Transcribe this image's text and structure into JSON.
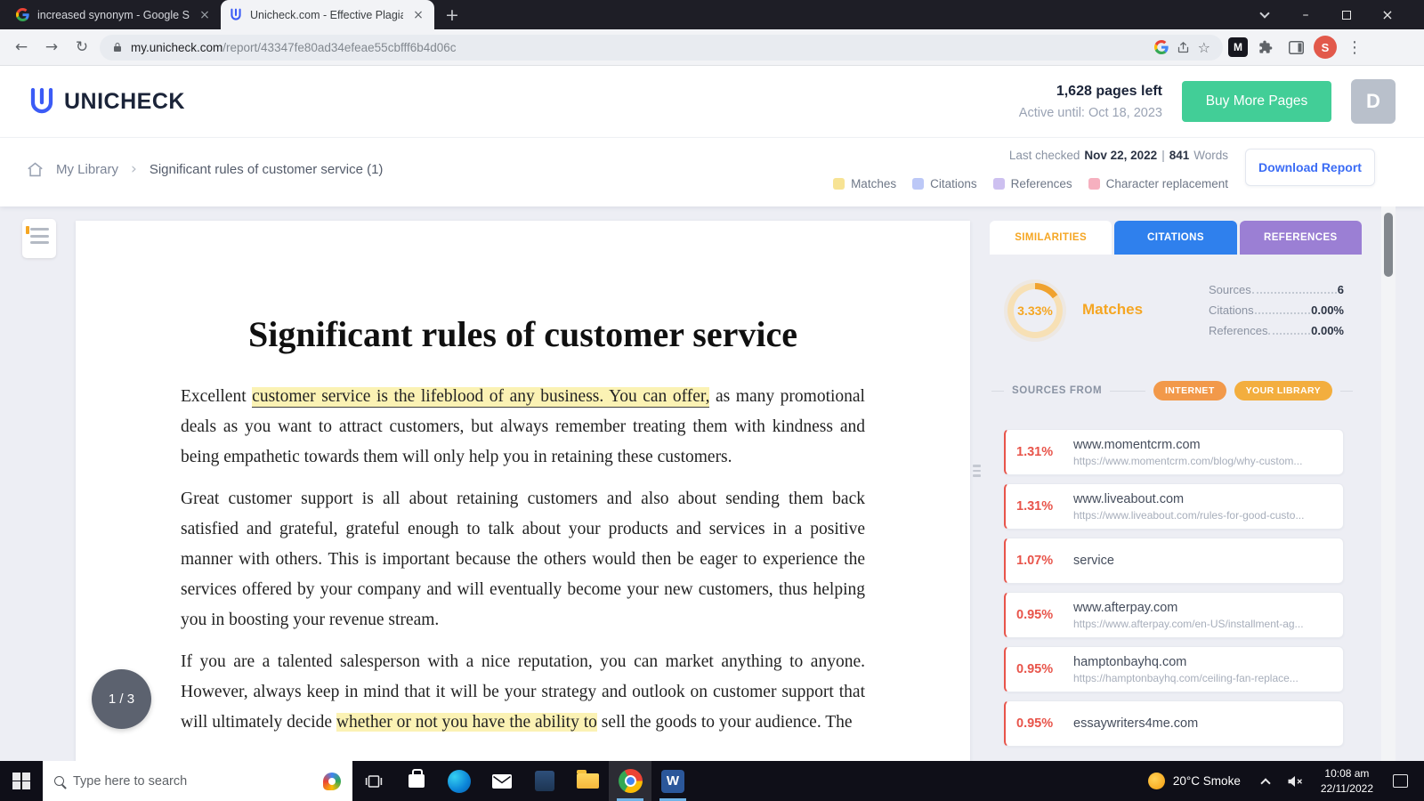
{
  "browser": {
    "tabs": [
      {
        "title": "increased synonym - Google Sea"
      },
      {
        "title": "Unicheck.com - Effective Plagiari"
      }
    ],
    "url_host": "my.unicheck.com",
    "url_path": "/report/43347fe80ad34efeae55cbfff6b4d06c",
    "profile_initial": "S",
    "extension_label": "M"
  },
  "header": {
    "brand": "UNICHECK",
    "pages_left": "1,628 pages left",
    "active_until": "Active until: Oct 18, 2023",
    "buy_more": "Buy More Pages",
    "account_initial": "D"
  },
  "breadcrumb": {
    "library": "My Library",
    "separator": "›",
    "doc": "Significant rules of customer service (1)",
    "last_checked_label": "Last checked",
    "last_checked_value": "Nov 22, 2022",
    "pipe": "|",
    "word_count": "841",
    "words_label": "Words",
    "download": "Download Report",
    "legend": [
      {
        "label": "Matches",
        "color": "#f7e394"
      },
      {
        "label": "Citations",
        "color": "#bcc8f7"
      },
      {
        "label": "References",
        "color": "#cdc0f0"
      },
      {
        "label": "Character replacement",
        "color": "#f6b0bf"
      }
    ]
  },
  "document": {
    "title": "Significant rules of customer service",
    "page_indicator": "1 / 3",
    "paragraphs": [
      {
        "segments": [
          {
            "text": "Excellent "
          },
          {
            "text": "customer service is the lifeblood of any business. You can offer,"
          },
          {
            "text": " as many promotional deals as you want to attract customers, but always remember treating them with kindness and being empathetic towards them will only help you in retaining these customers."
          }
        ]
      },
      {
        "segments": [
          {
            "text": "Great customer support is all about retaining customers and also about sending them back satisfied and grateful, grateful enough to talk about your products and services in a positive manner with others. This is important because the others would then be eager to experience the services offered by your company and will eventually become your new customers, thus helping you in boosting your revenue stream."
          }
        ]
      },
      {
        "segments": [
          {
            "text": "If you are a talented salesperson with a nice reputation, you can market anything to anyone. However, always keep in mind that it will be your strategy and outlook on customer support that will ultimately decide "
          },
          {
            "text": "whether or not you have the ability to"
          },
          {
            "text": " sell the goods to your audience. The"
          }
        ]
      }
    ]
  },
  "panel": {
    "tabs": [
      {
        "label": "SIMILARITIES"
      },
      {
        "label": "CITATIONS"
      },
      {
        "label": "REFERENCES"
      }
    ],
    "match_percent": "3.33%",
    "match_label": "Matches",
    "stats": [
      {
        "label": "Sources",
        "value": "6"
      },
      {
        "label": "Citations",
        "value": "0.00%"
      },
      {
        "label": "References",
        "value": "0.00%"
      }
    ],
    "sources_from": "SOURCES FROM",
    "filter_internet": "INTERNET",
    "filter_library": "YOUR LIBRARY",
    "sources": [
      {
        "percent": "1.31%",
        "domain": "www.momentcrm.com",
        "url": "https://www.momentcrm.com/blog/why-custom..."
      },
      {
        "percent": "1.31%",
        "domain": "www.liveabout.com",
        "url": "https://www.liveabout.com/rules-for-good-custo..."
      },
      {
        "percent": "1.07%",
        "domain": "service",
        "url": ""
      },
      {
        "percent": "0.95%",
        "domain": "www.afterpay.com",
        "url": "https://www.afterpay.com/en-US/installment-ag..."
      },
      {
        "percent": "0.95%",
        "domain": "hamptonbayhq.com",
        "url": "https://hamptonbayhq.com/ceiling-fan-replace..."
      },
      {
        "percent": "0.95%",
        "domain": "essaywriters4me.com",
        "url": ""
      }
    ]
  },
  "taskbar": {
    "search_placeholder": "Type here to search",
    "weather": "20°C Smoke",
    "time": "10:08 am",
    "date": "22/11/2022"
  },
  "colors": {
    "brand_blue": "#3b5bf6",
    "buy_green": "#42ce97",
    "similarity_orange": "#f5a623",
    "citations_blue": "#2f80ed",
    "references_purple": "#9b7fd4",
    "match_red": "#e8544a",
    "highlight_yellow": "#fbf2b4"
  }
}
